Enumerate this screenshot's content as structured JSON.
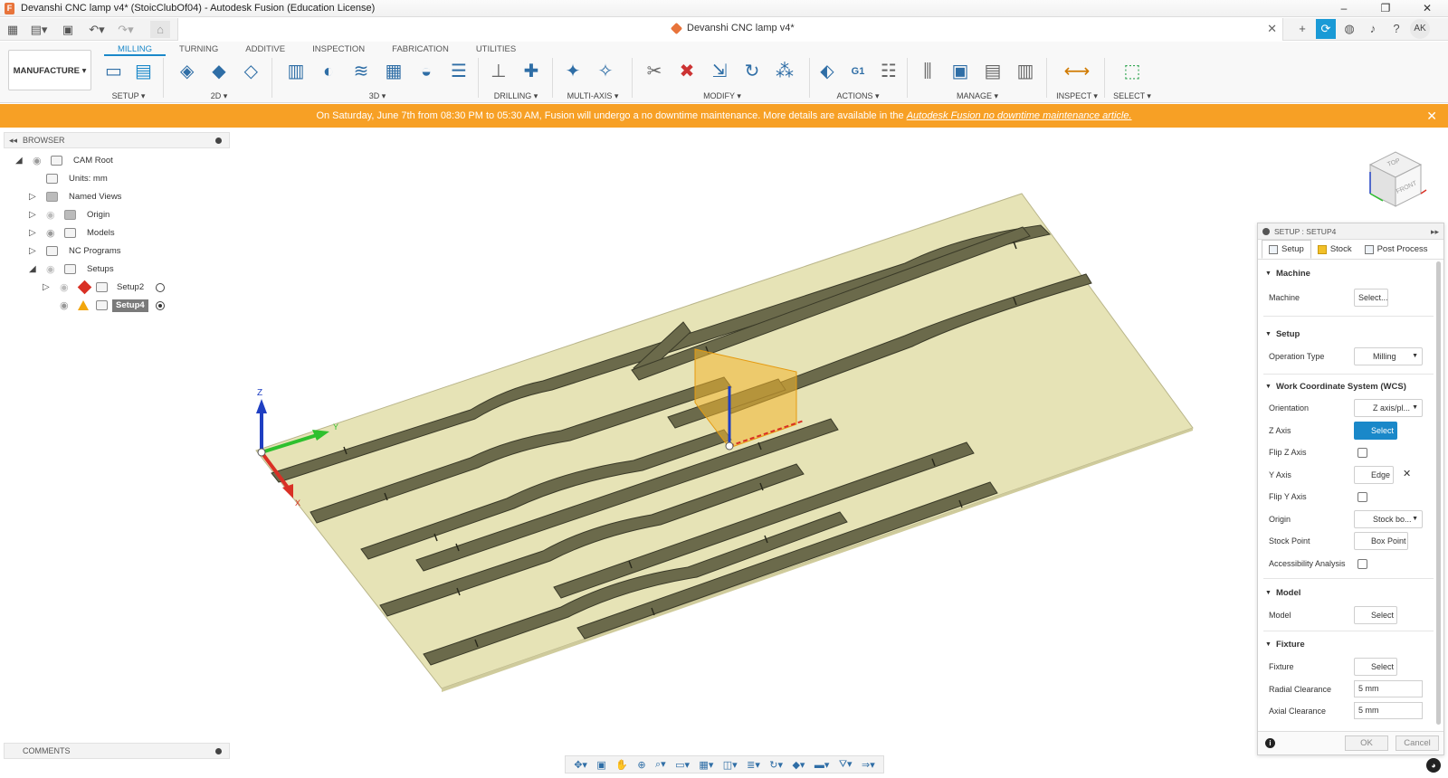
{
  "window": {
    "title": "Devanshi CNC lamp v4* (StoicClubOf04) - Autodesk Fusion (Education License)",
    "controls": [
      "–",
      "❐",
      "✕"
    ]
  },
  "document": {
    "tab_label": "Devanshi CNC lamp v4*",
    "close": "✕"
  },
  "user": {
    "initials": "AK"
  },
  "workspace": {
    "label": "MANUFACTURE ▾"
  },
  "ribbon": {
    "tabs": [
      "MILLING",
      "TURNING",
      "ADDITIVE",
      "INSPECTION",
      "FABRICATION",
      "UTILITIES"
    ],
    "active_tab": "MILLING",
    "groups": {
      "setup": "SETUP ▾",
      "twod": "2D ▾",
      "threed": "3D ▾",
      "drilling": "DRILLING ▾",
      "multiaxis": "MULTI-AXIS ▾",
      "modify": "MODIFY ▾",
      "actions": "ACTIONS ▾",
      "manage": "MANAGE ▾",
      "inspect": "INSPECT ▾",
      "select": "SELECT ▾"
    }
  },
  "banner": {
    "text": "On Saturday, June 7th from 08:30 PM to 05:30 AM, Fusion will undergo a no downtime maintenance. More details are available in the",
    "link": "Autodesk Fusion no downtime maintenance article.",
    "color": "#f7a025"
  },
  "browser": {
    "title": "BROWSER",
    "items": [
      {
        "label": "CAM Root"
      },
      {
        "label": "Units: mm"
      },
      {
        "label": "Named Views"
      },
      {
        "label": "Origin"
      },
      {
        "label": "Models"
      },
      {
        "label": "NC Programs"
      },
      {
        "label": "Setups"
      },
      {
        "label": "Setup2"
      },
      {
        "label": "Setup4"
      }
    ]
  },
  "comments": {
    "title": "COMMENTS"
  },
  "viewcube": {
    "top": "TOP",
    "front": "FRONT"
  },
  "axes": {
    "z": "Z",
    "y": "Y",
    "x": "X"
  },
  "panel": {
    "title": "SETUP : SETUP4",
    "tabs": [
      "Setup",
      "Stock",
      "Post Process"
    ],
    "sections": {
      "machine": "Machine",
      "setup": "Setup",
      "wcs": "Work Coordinate System (WCS)",
      "model": "Model",
      "fixture": "Fixture"
    },
    "fields": {
      "machine_label": "Machine",
      "machine_value": "Select...",
      "operation_type_label": "Operation Type",
      "operation_type_value": "Milling",
      "orientation_label": "Orientation",
      "orientation_value": "Z axis/pl...",
      "z_axis_label": "Z Axis",
      "z_axis_value": "Select",
      "flip_z_label": "Flip Z Axis",
      "y_axis_label": "Y Axis",
      "y_axis_value": "Edge",
      "flip_y_label": "Flip Y Axis",
      "origin_label": "Origin",
      "origin_value": "Stock bo...",
      "stock_point_label": "Stock Point",
      "stock_point_value": "Box Point",
      "accessibility_label": "Accessibility Analysis",
      "model_label": "Model",
      "model_value": "Select",
      "fixture_label": "Fixture",
      "fixture_value": "Select",
      "radial_clearance_label": "Radial Clearance",
      "radial_clearance_value": "5 mm",
      "axial_clearance_label": "Axial Clearance",
      "axial_clearance_value": "5 mm"
    },
    "ok": "OK",
    "cancel": "Cancel",
    "accent": "#1a88c9"
  }
}
